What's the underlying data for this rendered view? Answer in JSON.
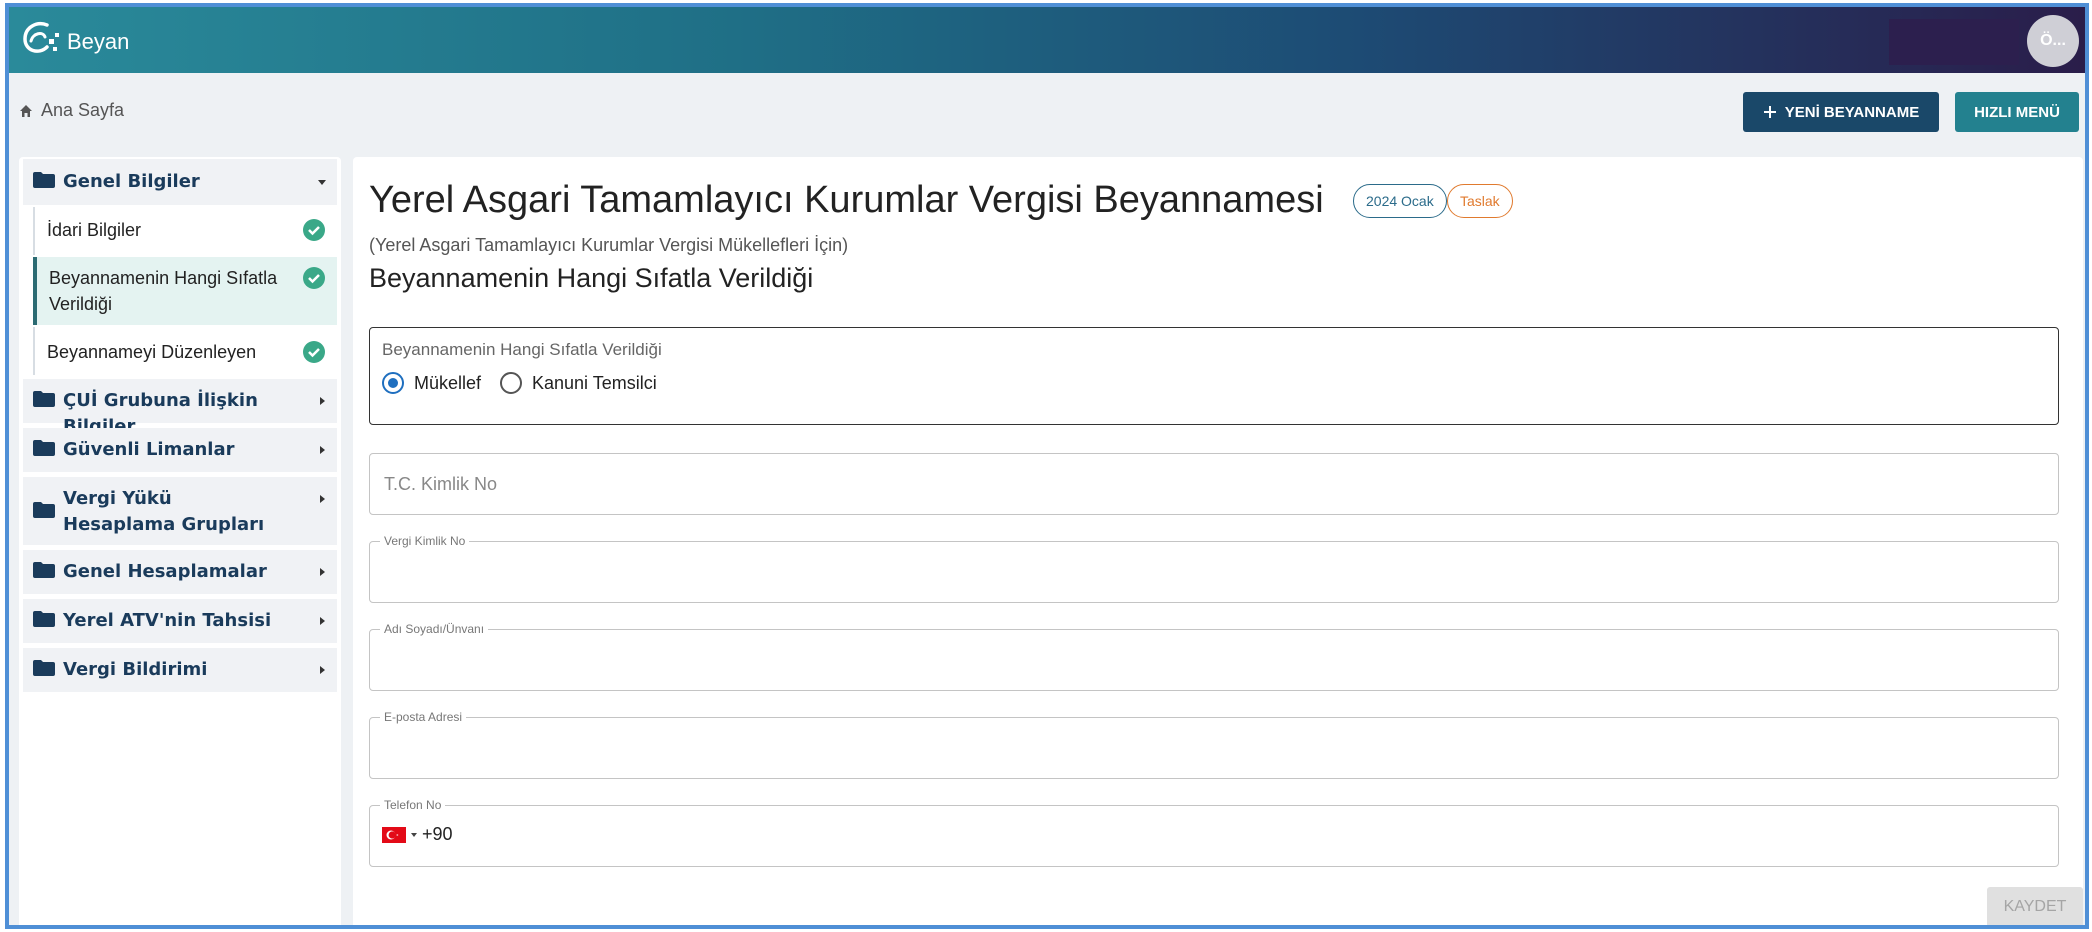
{
  "app": {
    "name": "Beyan",
    "avatar_initials": "Ö..."
  },
  "breadcrumb": {
    "home_label": "Ana Sayfa"
  },
  "toolbar": {
    "new_button_label": "YENİ BEYANNAME",
    "quick_menu_label": "HIZLI MENÜ"
  },
  "sidebar": {
    "groups": [
      {
        "label": "Genel Bilgiler",
        "expanded": true,
        "items": [
          {
            "label": "İdari Bilgiler",
            "completed": true
          },
          {
            "label": "Beyannamenin Hangi Sıfatla Verildiği",
            "completed": true,
            "active": true
          },
          {
            "label": "Beyannameyi Düzenleyen",
            "completed": true
          }
        ]
      },
      {
        "label": "ÇUİ Grubuna İlişkin Bilgiler",
        "expanded": false
      },
      {
        "label": "Güvenli Limanlar",
        "expanded": false
      },
      {
        "label": "Vergi Yükü Hesaplama Grupları",
        "expanded": false
      },
      {
        "label": "Genel Hesaplamalar",
        "expanded": false
      },
      {
        "label": "Yerel ATV'nin Tahsisi",
        "expanded": false
      },
      {
        "label": "Vergi Bildirimi",
        "expanded": false
      }
    ]
  },
  "main": {
    "title": "Yerel Asgari Tamamlayıcı Kurumlar Vergisi Beyannamesi",
    "period_chip": "2024 Ocak",
    "status_chip": "Taslak",
    "subtitle": "(Yerel Asgari Tamamlayıcı Kurumlar Vergisi Mükellefleri İçin)",
    "section_title": "Beyannamenin Hangi Sıfatla Verildiği",
    "capacity_group": {
      "legend": "Beyannamenin Hangi Sıfatla Verildiği",
      "options": [
        {
          "label": "Mükellef",
          "selected": true
        },
        {
          "label": "Kanuni Temsilci",
          "selected": false
        }
      ]
    },
    "fields": {
      "tckn_placeholder": "T.C. Kimlik No",
      "vkn_label": "Vergi Kimlik No",
      "name_label": "Adı Soyadı/Ünvanı",
      "email_label": "E-posta Adresi",
      "phone_label": "Telefon No",
      "phone_code": "+90"
    },
    "save_button_label": "KAYDET"
  },
  "colors": {
    "primary_dark": "#1a4869",
    "teal": "#23818f",
    "success": "#3aa888",
    "status_orange": "#e07a2e",
    "radio_blue": "#1f6fbf"
  }
}
